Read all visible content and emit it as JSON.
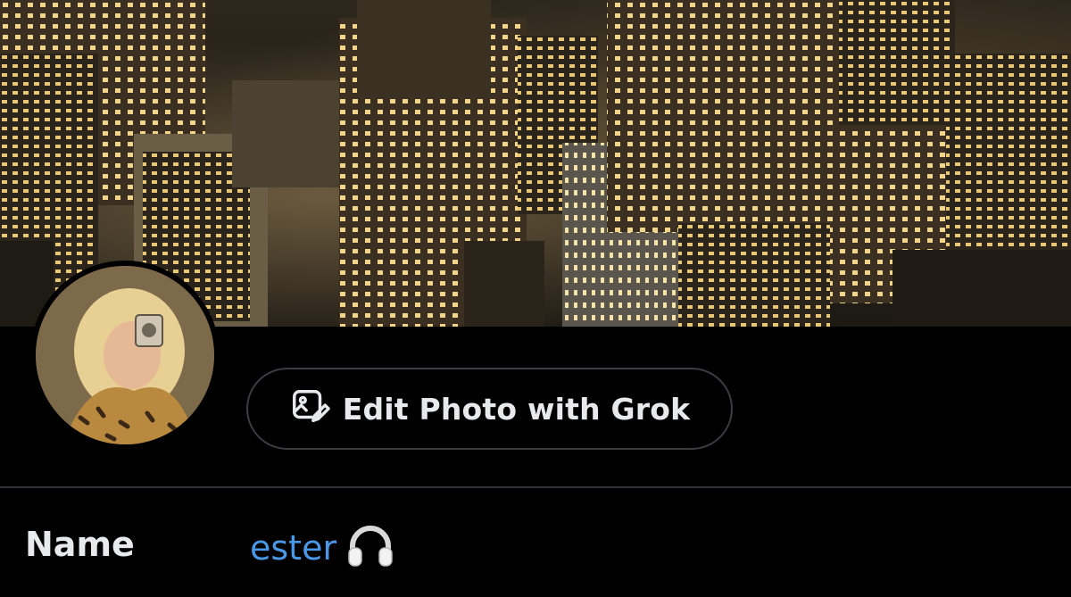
{
  "header": {
    "banner_image": "city-night-aerial",
    "avatar_image": "profile-photo"
  },
  "actions": {
    "edit_photo_label": "Edit Photo with Grok",
    "edit_photo_icon": "image-edit-icon"
  },
  "fields": {
    "name_label": "Name",
    "name_value": "ester",
    "name_emoji_icon": "headphones-icon"
  },
  "colors": {
    "background": "#000000",
    "link_blue": "#4a97e6",
    "border": "#3a3d41"
  }
}
